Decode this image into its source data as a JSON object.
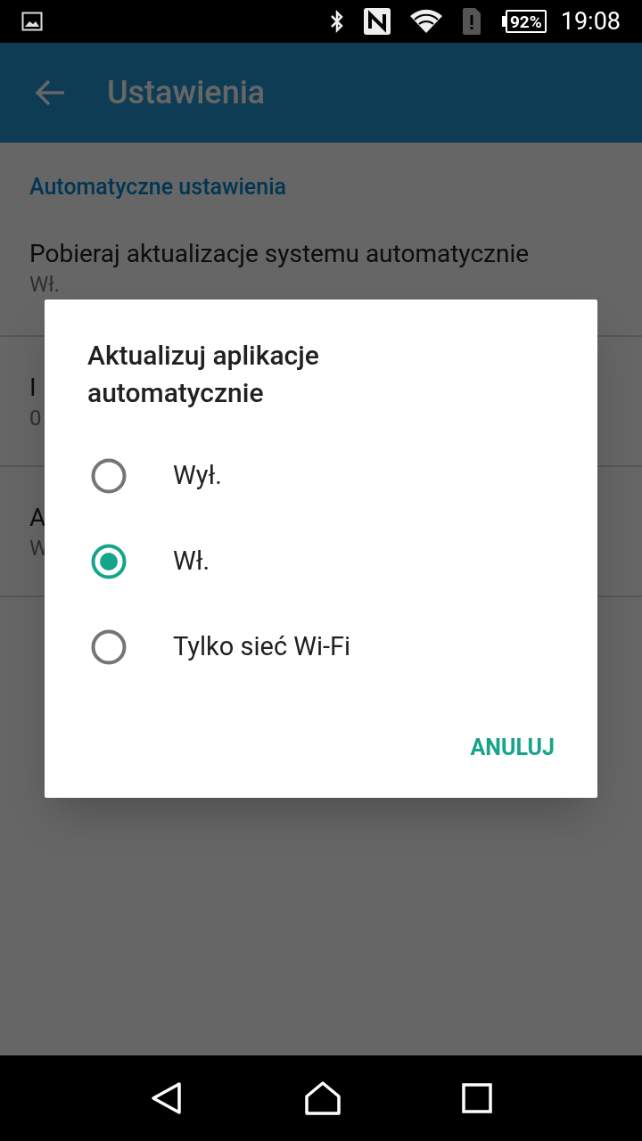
{
  "status_bar": {
    "battery": "92%",
    "time": "19:08"
  },
  "app_bar": {
    "title": "Ustawienia"
  },
  "settings": {
    "section": "Automatyczne ustawienia",
    "items": [
      {
        "title": "Pobieraj aktualizacje systemu automatycznie",
        "subtitle": "Wł."
      },
      {
        "title": "I",
        "subtitle": "0"
      },
      {
        "title": "A",
        "subtitle": "W"
      }
    ]
  },
  "dialog": {
    "title": "Aktualizuj aplikacje automatycznie",
    "options": [
      {
        "label": "Wył.",
        "selected": false
      },
      {
        "label": "Wł.",
        "selected": true
      },
      {
        "label": "Tylko sieć Wi-Fi",
        "selected": false
      }
    ],
    "button": "ANULUJ"
  }
}
